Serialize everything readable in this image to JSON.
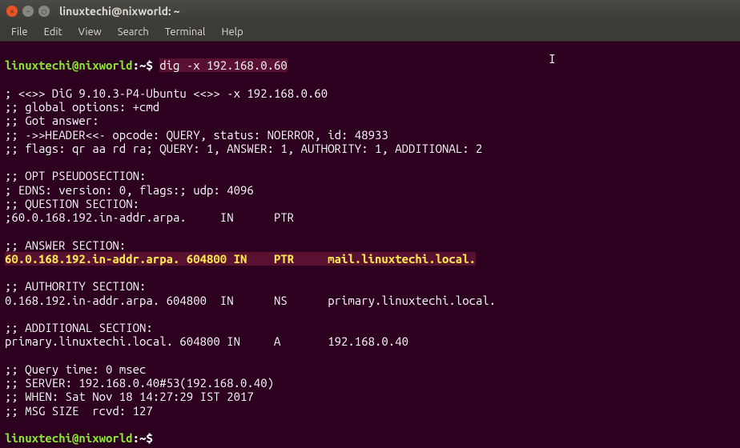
{
  "window": {
    "title": "linuxtechi@nixworld: ~"
  },
  "menu": {
    "file": "File",
    "edit": "Edit",
    "view": "View",
    "search": "Search",
    "terminal": "Terminal",
    "help": "Help"
  },
  "prompt": {
    "user_host": "linuxtechi@nixworld",
    "cwd": "~",
    "sep1": ":",
    "sep2": "$"
  },
  "command": "dig -x 192.168.0.60",
  "output": {
    "l1": "; <<>> DiG 9.10.3-P4-Ubuntu <<>> -x 192.168.0.60",
    "l2": ";; global options: +cmd",
    "l3": ";; Got answer:",
    "l4": ";; ->>HEADER<<- opcode: QUERY, status: NOERROR, id: 48933",
    "l5": ";; flags: qr aa rd ra; QUERY: 1, ANSWER: 1, AUTHORITY: 1, ADDITIONAL: 2",
    "l6": "",
    "l7": ";; OPT PSEUDOSECTION:",
    "l8": "; EDNS: version: 0, flags:; udp: 4096",
    "l9": ";; QUESTION SECTION:",
    "l10": ";60.0.168.192.in-addr.arpa.     IN      PTR",
    "l11": "",
    "l12": ";; ANSWER SECTION:",
    "l13": "60.0.168.192.in-addr.arpa. 604800 IN    PTR     mail.linuxtechi.local.",
    "l14": "",
    "l15": ";; AUTHORITY SECTION:",
    "l16": "0.168.192.in-addr.arpa. 604800  IN      NS      primary.linuxtechi.local.",
    "l17": "",
    "l18": ";; ADDITIONAL SECTION:",
    "l19": "primary.linuxtechi.local. 604800 IN     A       192.168.0.40",
    "l20": "",
    "l21": ";; Query time: 0 msec",
    "l22": ";; SERVER: 192.168.0.40#53(192.168.0.40)",
    "l23": ";; WHEN: Sat Nov 18 14:27:29 IST 2017",
    "l24": ";; MSG SIZE  rcvd: 127",
    "l25": ""
  }
}
